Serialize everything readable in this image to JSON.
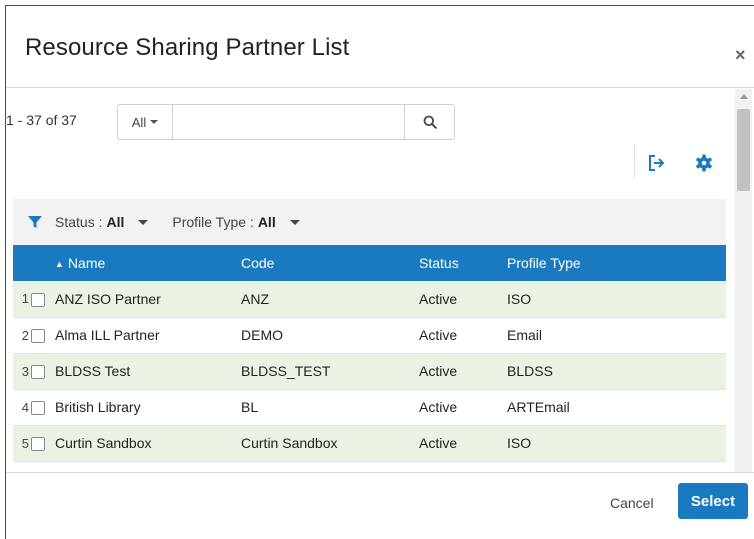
{
  "dialog": {
    "title": "Resource Sharing Partner List",
    "close_glyph": "×"
  },
  "toolbar": {
    "count": "1 - 37 of 37",
    "scope": "All",
    "search_value": "",
    "search_placeholder": "",
    "icons": [
      "search-icon",
      "export-icon",
      "gear-icon"
    ]
  },
  "filters": [
    {
      "label": "Status :",
      "value": "All"
    },
    {
      "label": "Profile Type :",
      "value": "All"
    }
  ],
  "table": {
    "columns": [
      "Name",
      "Code",
      "Status",
      "Profile Type"
    ],
    "sorted_column": "Name",
    "rows": [
      {
        "num": "1",
        "name": "ANZ ISO Partner",
        "code": "ANZ",
        "status": "Active",
        "profile": "ISO"
      },
      {
        "num": "2",
        "name": "Alma ILL Partner",
        "code": "DEMO",
        "status": "Active",
        "profile": "Email"
      },
      {
        "num": "3",
        "name": "BLDSS Test",
        "code": "BLDSS_TEST",
        "status": "Active",
        "profile": "BLDSS"
      },
      {
        "num": "4",
        "name": "British Library",
        "code": "BL",
        "status": "Active",
        "profile": "ARTEmail"
      },
      {
        "num": "5",
        "name": "Curtin Sandbox",
        "code": "Curtin Sandbox",
        "status": "Active",
        "profile": "ISO"
      }
    ]
  },
  "footer": {
    "cancel_label": "Cancel",
    "select_label": "Select"
  },
  "colors": {
    "accent": "#1a7abf",
    "row_stripe": "#eaf2e4",
    "filter_bg": "#f2f2f2"
  }
}
